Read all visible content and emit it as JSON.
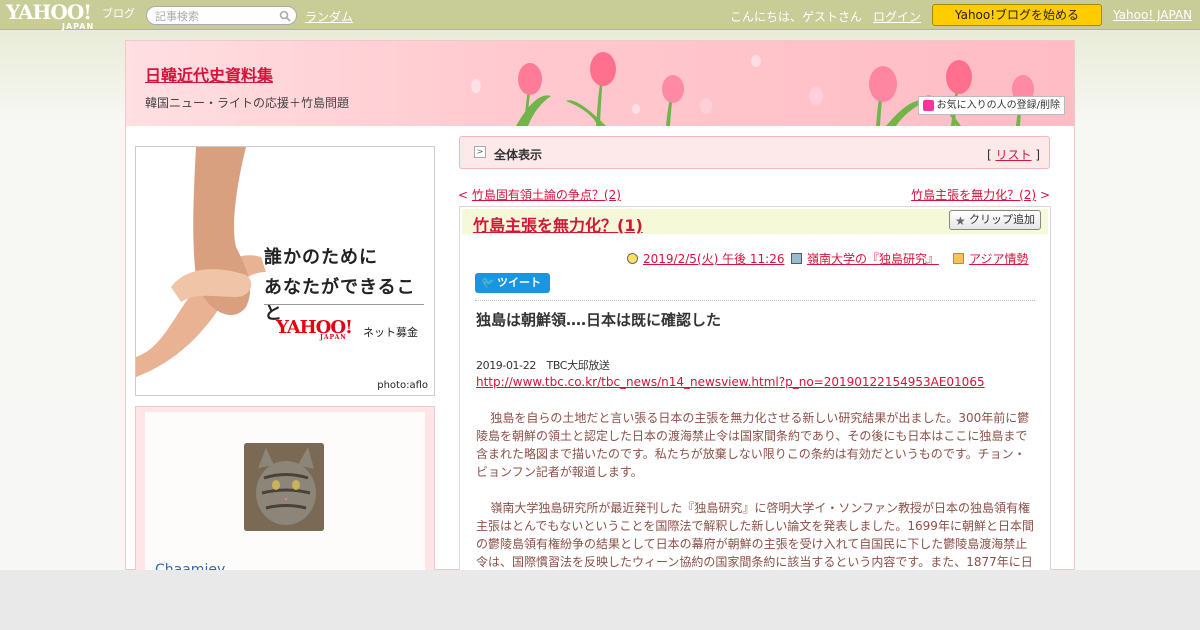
{
  "topbar": {
    "logo_text": "YAHOO!",
    "logo_japan": "JAPAN",
    "logo_blog": "ブログ",
    "search_placeholder": "記事検索",
    "random_label": "ランダム",
    "greeting": "こんにちは、ゲストさん",
    "login_label": "ログイン",
    "start_blog_label": "Yahoo!ブログを始める",
    "yahoo_japan_label": "Yahoo! JAPAN"
  },
  "header": {
    "blog_title": "日韓近代史資料集",
    "blog_subtitle": "韓国ニュー・ライトの応援＋竹島問題",
    "favorite_label": "お気に入りの人の登録/削除"
  },
  "banner": {
    "line1": "誰かのために",
    "line2": "あなたができること",
    "yahoo_logo": "YAHOO!",
    "yahoo_japan": "JAPAN",
    "service": "ネット募金",
    "credit": "photo:aflo"
  },
  "profile": {
    "nickname": "Chaamiey"
  },
  "nav_bar": {
    "label": "全体表示",
    "list_open": "[",
    "list_label": "リスト",
    "list_close": "]"
  },
  "pager": {
    "prev_symbol": "<",
    "prev_label": "竹島固有領土論の争点？(2)",
    "next_label": "竹島主張を無力化？(2)",
    "next_symbol": ">"
  },
  "article": {
    "title": "竹島主張を無力化？(1)",
    "clip_label": "クリップ追加",
    "datetime": "2019/2/5(火) 午後 11:26",
    "tag": "嶺南大学の『独島研究』",
    "category": "アジア情勢",
    "tweet_label": "ツイート",
    "heading": "独島は朝鮮領‥‥日本は既に確認した",
    "source_date": "2019-01-22　TBC大邱放送",
    "source_url": "http://www.tbc.co.kr/tbc_news/n14_newsview.html?p_no=20190122154953AE01065",
    "para1": "独島を自らの土地だと言い張る日本の主張を無力化させる新しい研究結果が出ました。300年前に鬱陵島を朝鮮の領土と認定した日本の渡海禁止令は国家間条約であり、その後にも日本はここに独島まで含まれた略図まで描いたのです。私たちが放棄しない限りこの条約は有効だというものです。チョン・ビョンフン記者が報道します。",
    "para2": "嶺南大学独島研究所が最近発刊した『独島研究』に啓明大学イ・ソンファン教授が日本の独島領有権主張はとんでもないということを国際法で解釈した新しい論文を発表しました。1699年に朝鮮と日本間の鬱陵島領有権紛争の結果として日本の幕府が朝鮮の主張を受け入れて自国民に下した鬱陵島渡海禁止令は、国際慣習法を反映したウィーン協約の国家間条約に該当するという内容です。また、1877年に日"
  },
  "colors": {
    "topbar": "#c8cd98",
    "accent_red": "#d4143a",
    "header_pink": "#ffc9cf",
    "title_bar": "#f6f9d8",
    "body_text": "#8b5048"
  }
}
